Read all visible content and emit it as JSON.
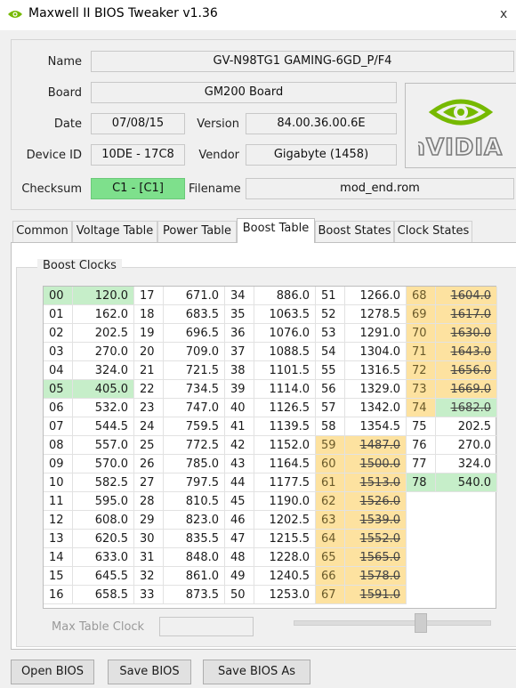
{
  "window": {
    "title": "Maxwell II BIOS Tweaker v1.36",
    "close_glyph": "x"
  },
  "info": {
    "name_label": "Name",
    "name_value": "GV-N98TG1 GAMING-6GD_P/F4",
    "board_label": "Board",
    "board_value": "GM200 Board",
    "date_label": "Date",
    "date_value": "07/08/15",
    "version_label": "Version",
    "version_value": "84.00.36.00.6E",
    "device_label": "Device ID",
    "device_value": "10DE - 17C8",
    "vendor_label": "Vendor",
    "vendor_value": "Gigabyte (1458)",
    "checksum_label": "Checksum",
    "checksum_value": "C1 - [C1]",
    "filename_label": "Filename",
    "filename_value": "mod_end.rom",
    "logo_text": "nVIDIA.",
    "logo_icon": "nvidia-eye-logo"
  },
  "tabs": [
    "Common",
    "Voltage Table",
    "Power Table",
    "Boost Table",
    "Boost States",
    "Clock States"
  ],
  "active_tab": "Boost Table",
  "boost": {
    "group_title": "Boost Clocks",
    "columns": [
      [
        [
          "00",
          "120.0",
          "g"
        ],
        [
          "01",
          "162.0",
          ""
        ],
        [
          "02",
          "202.5",
          ""
        ],
        [
          "03",
          "270.0",
          ""
        ],
        [
          "04",
          "324.0",
          ""
        ],
        [
          "05",
          "405.0",
          "g"
        ],
        [
          "06",
          "532.0",
          ""
        ],
        [
          "07",
          "544.5",
          ""
        ],
        [
          "08",
          "557.0",
          ""
        ],
        [
          "09",
          "570.0",
          ""
        ],
        [
          "10",
          "582.5",
          ""
        ],
        [
          "11",
          "595.0",
          ""
        ],
        [
          "12",
          "608.0",
          ""
        ],
        [
          "13",
          "620.5",
          ""
        ],
        [
          "14",
          "633.0",
          ""
        ],
        [
          "15",
          "645.5",
          ""
        ],
        [
          "16",
          "658.5",
          ""
        ]
      ],
      [
        [
          "17",
          "671.0",
          ""
        ],
        [
          "18",
          "683.5",
          ""
        ],
        [
          "19",
          "696.5",
          ""
        ],
        [
          "20",
          "709.0",
          ""
        ],
        [
          "21",
          "721.5",
          ""
        ],
        [
          "22",
          "734.5",
          ""
        ],
        [
          "23",
          "747.0",
          ""
        ],
        [
          "24",
          "759.5",
          ""
        ],
        [
          "25",
          "772.5",
          ""
        ],
        [
          "26",
          "785.0",
          ""
        ],
        [
          "27",
          "797.5",
          ""
        ],
        [
          "28",
          "810.5",
          ""
        ],
        [
          "29",
          "823.0",
          ""
        ],
        [
          "30",
          "835.5",
          ""
        ],
        [
          "31",
          "848.0",
          ""
        ],
        [
          "32",
          "861.0",
          ""
        ],
        [
          "33",
          "873.5",
          ""
        ]
      ],
      [
        [
          "34",
          "886.0",
          ""
        ],
        [
          "35",
          "1063.5",
          ""
        ],
        [
          "36",
          "1076.0",
          ""
        ],
        [
          "37",
          "1088.5",
          ""
        ],
        [
          "38",
          "1101.5",
          ""
        ],
        [
          "39",
          "1114.0",
          ""
        ],
        [
          "40",
          "1126.5",
          ""
        ],
        [
          "41",
          "1139.5",
          ""
        ],
        [
          "42",
          "1152.0",
          ""
        ],
        [
          "43",
          "1164.5",
          ""
        ],
        [
          "44",
          "1177.5",
          ""
        ],
        [
          "45",
          "1190.0",
          ""
        ],
        [
          "46",
          "1202.5",
          ""
        ],
        [
          "47",
          "1215.5",
          ""
        ],
        [
          "48",
          "1228.0",
          ""
        ],
        [
          "49",
          "1240.5",
          ""
        ],
        [
          "50",
          "1253.0",
          ""
        ]
      ],
      [
        [
          "51",
          "1266.0",
          ""
        ],
        [
          "52",
          "1278.5",
          ""
        ],
        [
          "53",
          "1291.0",
          ""
        ],
        [
          "54",
          "1304.0",
          ""
        ],
        [
          "55",
          "1316.5",
          ""
        ],
        [
          "56",
          "1329.0",
          ""
        ],
        [
          "57",
          "1342.0",
          ""
        ],
        [
          "58",
          "1354.5",
          ""
        ],
        [
          "59",
          "1487.0",
          "y"
        ],
        [
          "60",
          "1500.0",
          "y"
        ],
        [
          "61",
          "1513.0",
          "y"
        ],
        [
          "62",
          "1526.0",
          "y"
        ],
        [
          "63",
          "1539.0",
          "y"
        ],
        [
          "64",
          "1552.0",
          "y"
        ],
        [
          "65",
          "1565.0",
          "y"
        ],
        [
          "66",
          "1578.0",
          "y"
        ],
        [
          "67",
          "1591.0",
          "y"
        ]
      ],
      [
        [
          "68",
          "1604.0",
          "y"
        ],
        [
          "69",
          "1617.0",
          "y"
        ],
        [
          "70",
          "1630.0",
          "y"
        ],
        [
          "71",
          "1643.0",
          "y"
        ],
        [
          "72",
          "1656.0",
          "y"
        ],
        [
          "73",
          "1669.0",
          "y"
        ],
        [
          "74",
          "1682.0",
          "gy"
        ],
        [
          "75",
          "202.5",
          ""
        ],
        [
          "76",
          "270.0",
          ""
        ],
        [
          "77",
          "324.0",
          ""
        ],
        [
          "78",
          "540.0",
          "g"
        ]
      ]
    ],
    "max_label": "Max Table Clock",
    "max_value": "",
    "slider_position": 0.65
  },
  "buttons": {
    "open": "Open BIOS",
    "save": "Save BIOS",
    "save_as": "Save BIOS As"
  },
  "colors": {
    "highlight_green": "#c6eec9",
    "checksum_green": "#7ee08c",
    "disabled_yellow": "#fde2a0"
  }
}
